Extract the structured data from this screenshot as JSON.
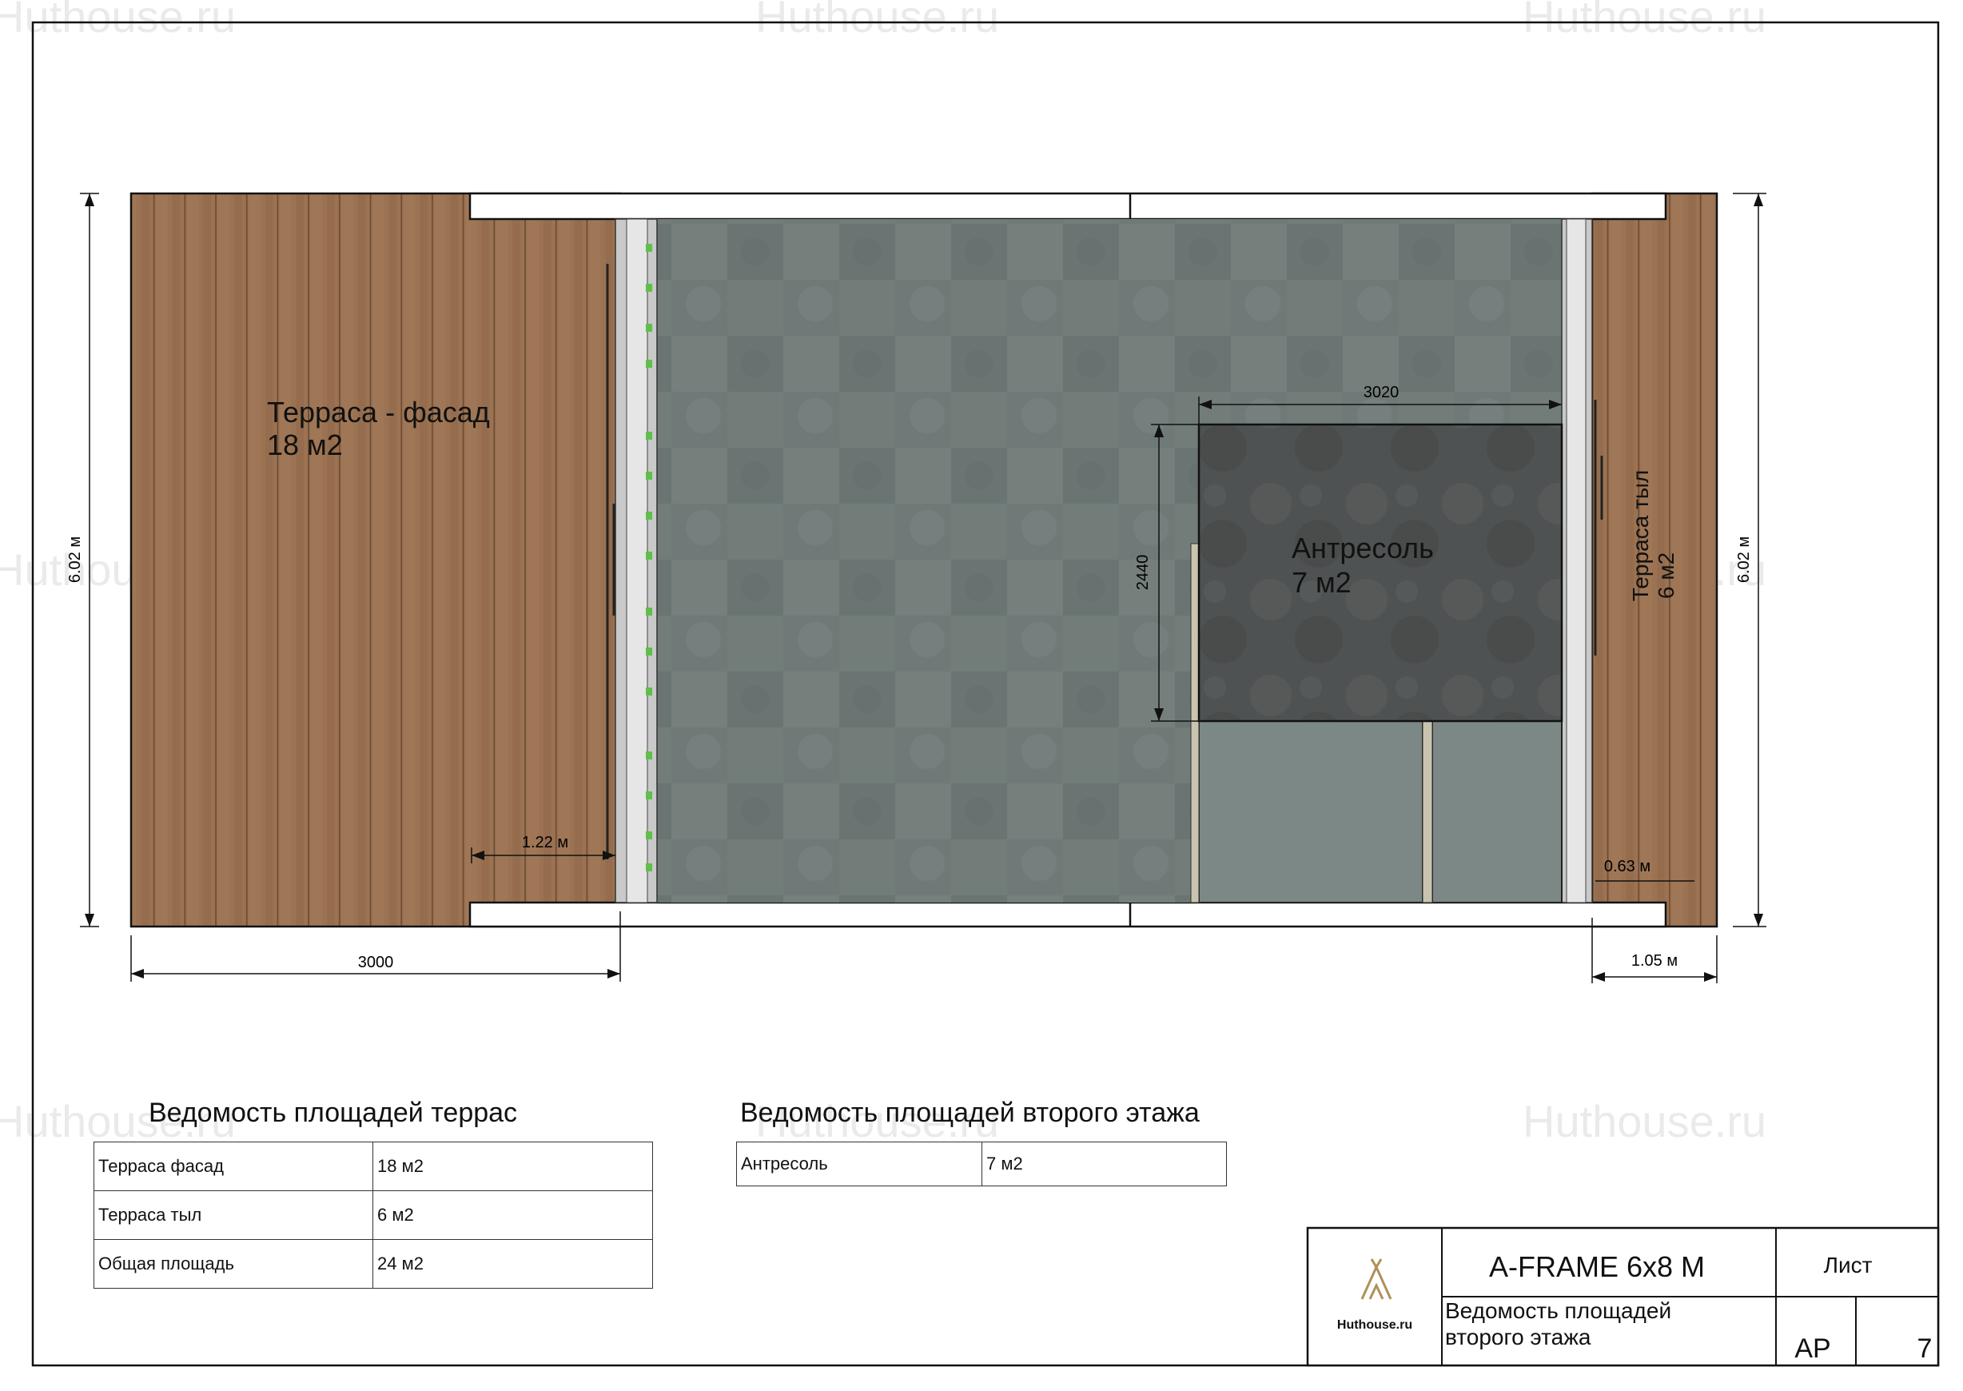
{
  "watermark": "Huthouse.ru",
  "plan": {
    "terrace_front": {
      "name": "Терраса - фасад",
      "area": "18 м2"
    },
    "terrace_back": {
      "name": "Терраса тыл",
      "area": "6 м2"
    },
    "mezzanine": {
      "name": "Антресоль",
      "area": "7 м2"
    },
    "dimensions": {
      "height_left": "6.02 м",
      "height_right": "6.02 м",
      "front_width": "3000",
      "front_inner": "1.22 м",
      "mezz_width": "3020",
      "mezz_depth": "2440",
      "back_inner": "0.63 м",
      "back_width": "1.05 м"
    }
  },
  "terrace_table": {
    "title": "Ведомость площадей террас",
    "rows": [
      [
        "Терраса фасад",
        "18 м2"
      ],
      [
        "Терраса тыл",
        "6 м2"
      ],
      [
        "Общая площадь",
        "24 м2"
      ]
    ]
  },
  "floor2_table": {
    "title": "Ведомость площадей второго этажа",
    "rows": [
      [
        "Антресоль",
        "7 м2"
      ]
    ]
  },
  "title_block": {
    "logo_text": "Huthouse.ru",
    "project": "A-FRAME 6x8 M",
    "sheet_label": "Лист",
    "sheet_title_line1": "Ведомость площадей",
    "sheet_title_line2": "второго этажа",
    "code": "АР",
    "number": "7"
  },
  "colors": {
    "wood": "#9c7352",
    "wood_dark": "#7d5a3f",
    "floor": "#6f7a78",
    "mezzanine": "#4f5252",
    "frame": "#111111"
  }
}
